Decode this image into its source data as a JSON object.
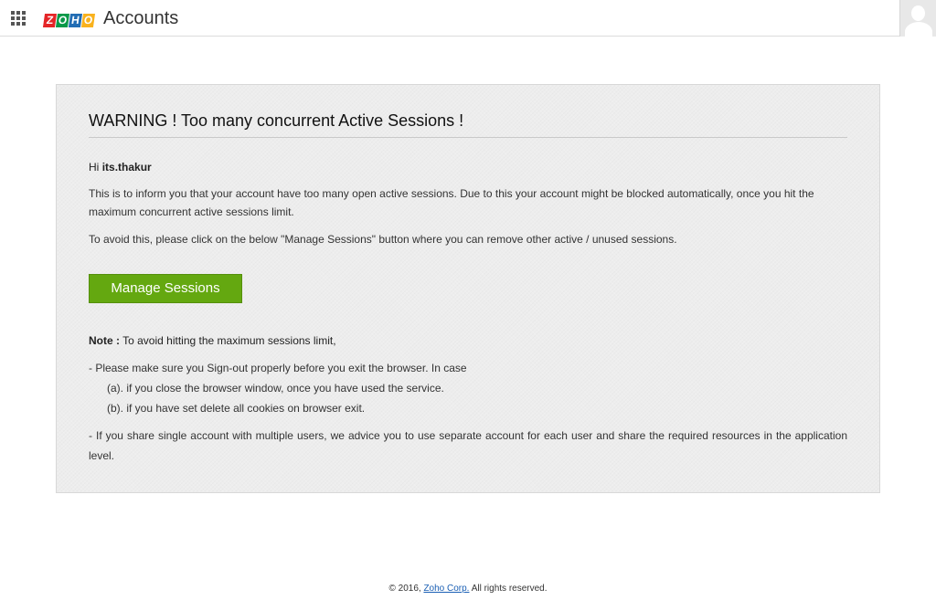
{
  "header": {
    "logo_letters": [
      "Z",
      "O",
      "H",
      "O"
    ],
    "logo_colors": [
      "#e42527",
      "#089949",
      "#226db4",
      "#f9b21d"
    ],
    "app_name": "Accounts",
    "apps_icon": "apps-grid-icon",
    "avatar_icon": "user-avatar-icon"
  },
  "panel": {
    "title": "WARNING ! Too many concurrent Active Sessions !",
    "greeting_prefix": "Hi",
    "username": "its.thakur",
    "paragraph1": "This is to inform you that your account have too many open active sessions. Due to this your account might be blocked automatically, once you hit the maximum concurrent active sessions limit.",
    "paragraph2": "To avoid this, please click on the below \"Manage Sessions\" button where you can remove other active / unused sessions.",
    "button_label": "Manage Sessions",
    "button_color": "#64a810",
    "note_label": "Note :",
    "note_text": "To avoid hitting the maximum sessions limit,",
    "rule1": "- Please make sure you Sign-out properly before you exit the browser. In case",
    "rule1_a": "(a). if you close the browser window, once you have used the service.",
    "rule1_b": "(b). if you have set delete all cookies on browser exit.",
    "rule2": "- If you share single account with multiple users, we advice you to use separate account for each user and share the required resources in the application level."
  },
  "footer": {
    "prefix": "© 2016,",
    "link": "Zoho Corp.",
    "suffix": "All rights reserved."
  }
}
